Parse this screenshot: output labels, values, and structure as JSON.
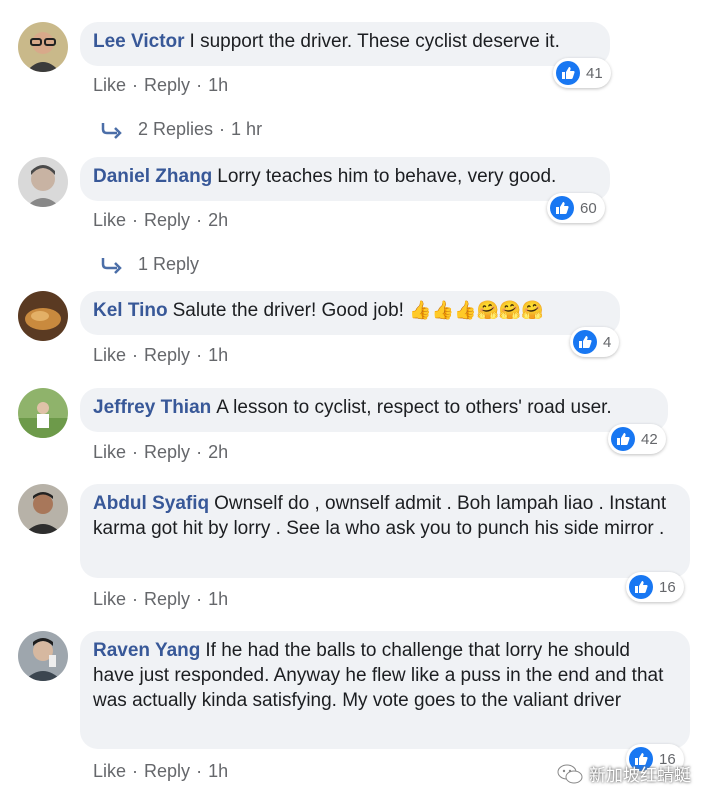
{
  "comments": [
    {
      "author": "Lee Victor",
      "text": "I support the driver. These cyclist deserve it.",
      "likes": "41",
      "like_label": "Like",
      "reply_label": "Reply",
      "time": "1h",
      "avatar": "avatar-glasses",
      "replies": {
        "count_text": "2 Replies",
        "time": "1 hr"
      }
    },
    {
      "author": "Daniel Zhang",
      "text": "Lorry teaches him to behave, very good.",
      "likes": "60",
      "like_label": "Like",
      "reply_label": "Reply",
      "time": "2h",
      "avatar": "avatar-grey",
      "replies": {
        "count_text": "1 Reply",
        "time": ""
      }
    },
    {
      "author": "Kel Tino",
      "text": "Salute the driver! Good job!",
      "emojis": "👍👍👍🤗🤗🤗",
      "likes": "4",
      "like_label": "Like",
      "reply_label": "Reply",
      "time": "1h",
      "avatar": "avatar-food"
    },
    {
      "author": "Jeffrey Thian",
      "text": "A lesson to cyclist, respect to others' road user.",
      "likes": "42",
      "like_label": "Like",
      "reply_label": "Reply",
      "time": "2h",
      "avatar": "avatar-outdoor"
    },
    {
      "author": "Abdul Syafiq",
      "text": "Ownself do , ownself admit . Boh lampah liao . Instant karma got hit by lorry . See la who ask you to punch his side mirror .",
      "likes": "16",
      "like_label": "Like",
      "reply_label": "Reply",
      "time": "1h",
      "avatar": "avatar-man"
    },
    {
      "author": "Raven Yang",
      "text": "If he had the balls to challenge that lorry he should have just responded. Anyway he flew like a puss in the end and that was actually kinda satisfying. My vote goes to the valiant driver",
      "likes": "16",
      "like_label": "Like",
      "reply_label": "Reply",
      "time": "1h",
      "avatar": "avatar-selfie"
    }
  ],
  "watermark": {
    "text": "新加坡红蜻蜓"
  },
  "colors": {
    "author": "#385898",
    "bubble": "#f0f2f5",
    "like_blue": "#1877f2",
    "meta": "#65676b"
  }
}
